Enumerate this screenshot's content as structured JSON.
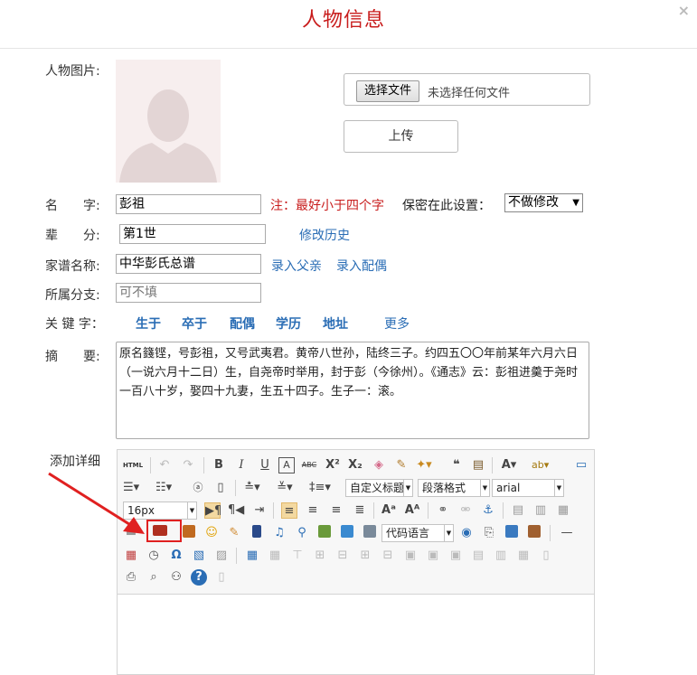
{
  "dialog": {
    "title": "人物信息",
    "close_icon": "close-icon"
  },
  "photo": {
    "label": "人物图片:",
    "choose_file_label": "选择文件",
    "no_file_text": "未选择任何文件",
    "upload_label": "上传"
  },
  "name": {
    "label": "名　　字:",
    "value": "彭祖",
    "note": "注：最好小于四个字",
    "privacy_label": "保密在此设置：",
    "privacy_value": "不做修改"
  },
  "generation": {
    "label": "辈　　分:",
    "value": "第1世",
    "history_link": "修改历史"
  },
  "genealogy": {
    "label": "家谱名称:",
    "value": "中华彭氏总谱",
    "add_father_link": "录入父亲",
    "add_spouse_link": "录入配偶"
  },
  "branch": {
    "label": "所属分支:",
    "placeholder": "可不填"
  },
  "keywords": {
    "label": "关 键 字：",
    "items": [
      "生于",
      "卒于",
      "配偶",
      "学历",
      "地址"
    ],
    "more": "更多"
  },
  "summary": {
    "label": "摘　　要:",
    "text": "原名籛铿，号彭祖，又号武夷君。黄帝八世孙，陆终三子。约四五〇〇年前某年六月六日（一说六月十二日）生，自尧帝时举用，封于彭（今徐州）。《通志》云：彭祖进羹于尧时一百八十岁，娶四十九妻，生五十四子。生子一：滚。"
  },
  "detail": {
    "label": "添加详细"
  },
  "editor": {
    "custom_title_select": "自定义标题",
    "paragraph_select": "段落格式",
    "font_select": "arial",
    "font_size_select": "16px",
    "code_language_select": "代码语言",
    "source_label": "HTML"
  },
  "colors": {
    "title_red": "#c81c1c",
    "link_blue": "#2a6db5",
    "annotation_red": "#e02020"
  }
}
